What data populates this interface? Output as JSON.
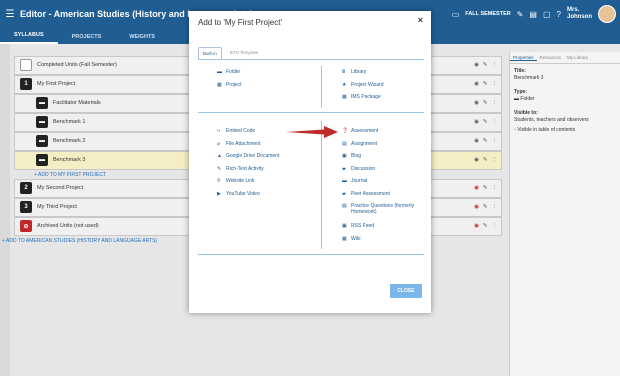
{
  "header": {
    "title": "Editor - American Studies (History and Language Arts)",
    "semester": "FALL SEMESTER",
    "user_line1": "Mrs.",
    "user_line2": "Johnson"
  },
  "tabs": [
    {
      "label": "SYLLABUS"
    },
    {
      "label": "PROJECTS"
    },
    {
      "label": "WEIGHTS"
    }
  ],
  "tree": {
    "rows": [
      {
        "label": "Completed Units (Fall Semester)",
        "marker": ""
      },
      {
        "label": "My First Project",
        "marker": "1"
      },
      {
        "label": "Facilitator Materials",
        "marker": ""
      },
      {
        "label": "Benchmark 1",
        "marker": ""
      },
      {
        "label": "Benchmark 2",
        "marker": ""
      },
      {
        "label": "Benchmark 3",
        "marker": ""
      },
      {
        "label": "My Second Project",
        "marker": "2"
      },
      {
        "label": "My Third Project",
        "marker": "3"
      },
      {
        "label": "Archived Units (not used)",
        "marker": ""
      }
    ],
    "add_to_project": "+ ADD TO MY FIRST PROJECT",
    "add_to_course": "+ ADD TO AMERICAN STUDIES (HISTORY AND LANGUAGE ARTS)"
  },
  "right_panel": {
    "tabs": [
      "Properties",
      "Resources",
      "My Library"
    ],
    "title_label": "Title:",
    "title_value": "Benchmark 3",
    "type_label": "Type:",
    "type_value": "Folder",
    "visible_label": "Visible to:",
    "visible_value": "Students, teachers and observers",
    "visible_toc": "Visible in table of contents"
  },
  "modal": {
    "title": "Add to 'My First Project'",
    "close_x": "×",
    "tabs": [
      "Built-in",
      "BTN Template"
    ],
    "section1_left": [
      "Folder",
      "Project"
    ],
    "section1_right": [
      "Library",
      "Project Wizard",
      "IMS Package"
    ],
    "section2_left": [
      "Embed Code",
      "File Attachment",
      "Google Drive Document",
      "Rich-Text Activity",
      "Website Link",
      "YouTube Video"
    ],
    "section2_right": [
      "Assessment",
      "Assignment",
      "Blog",
      "Discussion",
      "Journal",
      "Peer Assessment",
      "Practice Questions (formerly Homework)",
      "RSS Feed",
      "Wiki"
    ],
    "close_button": "CLOSE"
  },
  "icons": {
    "menu": "menu-icon",
    "calendar": "calendar-icon",
    "wrench": "wrench-icon",
    "doc": "document-icon",
    "help": "help-icon",
    "eye": "eye-icon",
    "pencil": "pencil-icon",
    "more": "more-vertical-icon"
  },
  "colors": {
    "header": "#1f5d93",
    "link": "#1f6fc0",
    "highlight_row": "#f5eec5",
    "close_button": "#7ab6e8",
    "arrow": "#c0282a"
  }
}
